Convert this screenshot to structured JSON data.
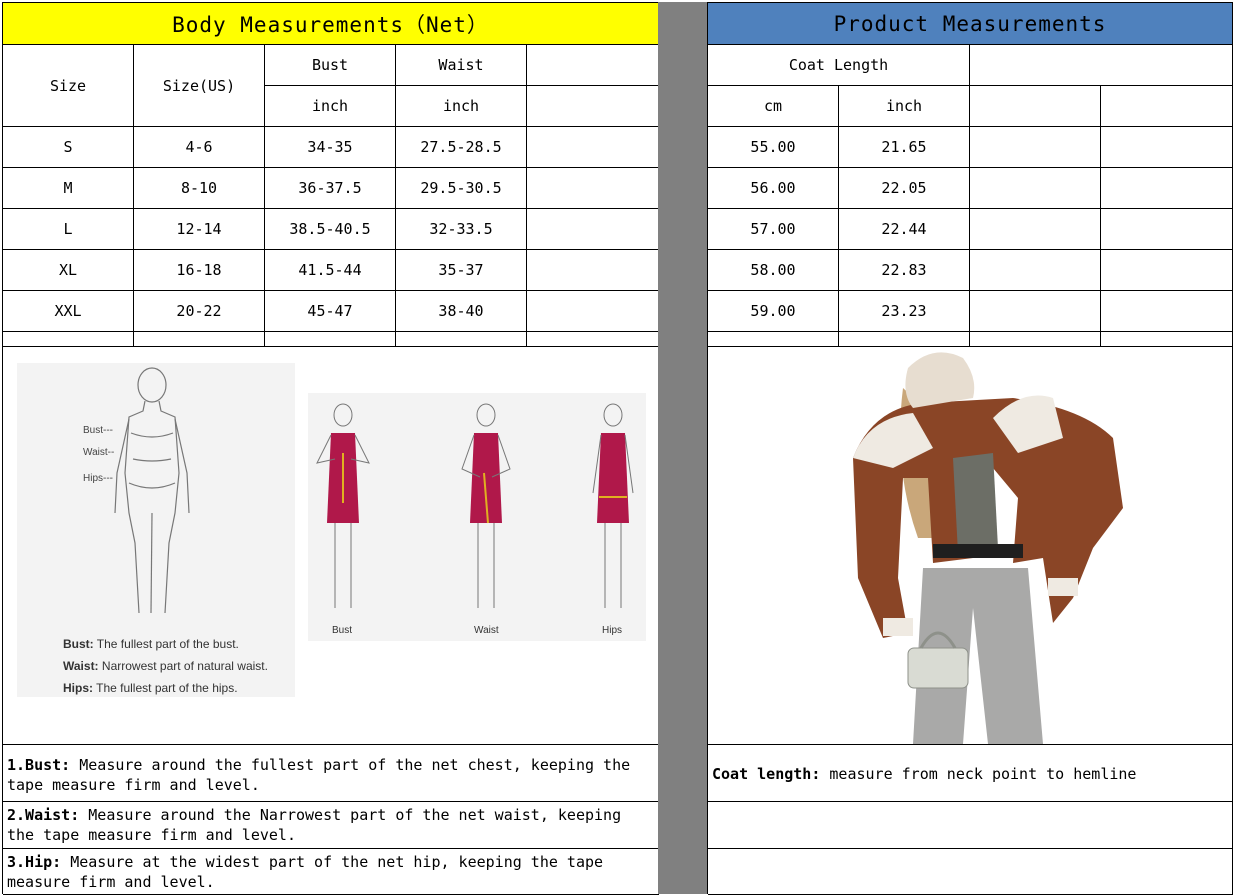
{
  "left": {
    "title": "Body Measurements（Net）",
    "title_bg": "#ffff00",
    "col_size": "Size",
    "col_size_us": "Size(US)",
    "col_bust": "Bust",
    "col_waist": "Waist",
    "unit_bust": "inch",
    "unit_waist": "inch",
    "rows": [
      {
        "size": "S",
        "us": "4-6",
        "bust": "34-35",
        "waist": "27.5-28.5"
      },
      {
        "size": "M",
        "us": "8-10",
        "bust": "36-37.5",
        "waist": "29.5-30.5"
      },
      {
        "size": "L",
        "us": "12-14",
        "bust": "38.5-40.5",
        "waist": "32-33.5"
      },
      {
        "size": "XL",
        "us": "16-18",
        "bust": "41.5-44",
        "waist": "35-37"
      },
      {
        "size": "XXL",
        "us": "20-22",
        "bust": "45-47",
        "waist": "38-40"
      }
    ],
    "figure": {
      "labels": [
        "Bust---",
        "Waist--",
        "Hips---"
      ],
      "bust_label": "Bust:",
      "bust_text": "The fullest part of the bust.",
      "waist_label": "Waist:",
      "waist_text": "Narrowest part of natural waist.",
      "hips_label": "Hips:",
      "hips_text": "The fullest part of the hips.",
      "steps": [
        "Bust",
        "Waist",
        "Hips"
      ]
    },
    "notes": {
      "bust_label": "1.Bust:",
      "bust_text": " Measure around the fullest part of the net chest, keeping the tape  measure firm and level.",
      "waist_label": "2.Waist:",
      "waist_text": " Measure around the Narrowest part of the net waist, keeping the tape  measure firm and level.",
      "hip_label": "3.Hip:",
      "hip_text": " Measure at the widest part of the net hip, keeping the tape measure firm and level."
    }
  },
  "right": {
    "title": "Product Measurements",
    "title_bg": "#4f81bd",
    "col_coat": "Coat Length",
    "unit_cm": "cm",
    "unit_inch": "inch",
    "rows": [
      {
        "cm": "55.00",
        "inch": "21.65"
      },
      {
        "cm": "56.00",
        "inch": "22.05"
      },
      {
        "cm": "57.00",
        "inch": "22.44"
      },
      {
        "cm": "58.00",
        "inch": "22.83"
      },
      {
        "cm": "59.00",
        "inch": "23.23"
      }
    ],
    "note_label": "Coat length:",
    "note_text": " measure from neck point to hemline"
  },
  "colors": {
    "dress": "#b0184a",
    "jacket": "#8a4526",
    "separator": "#808080"
  }
}
